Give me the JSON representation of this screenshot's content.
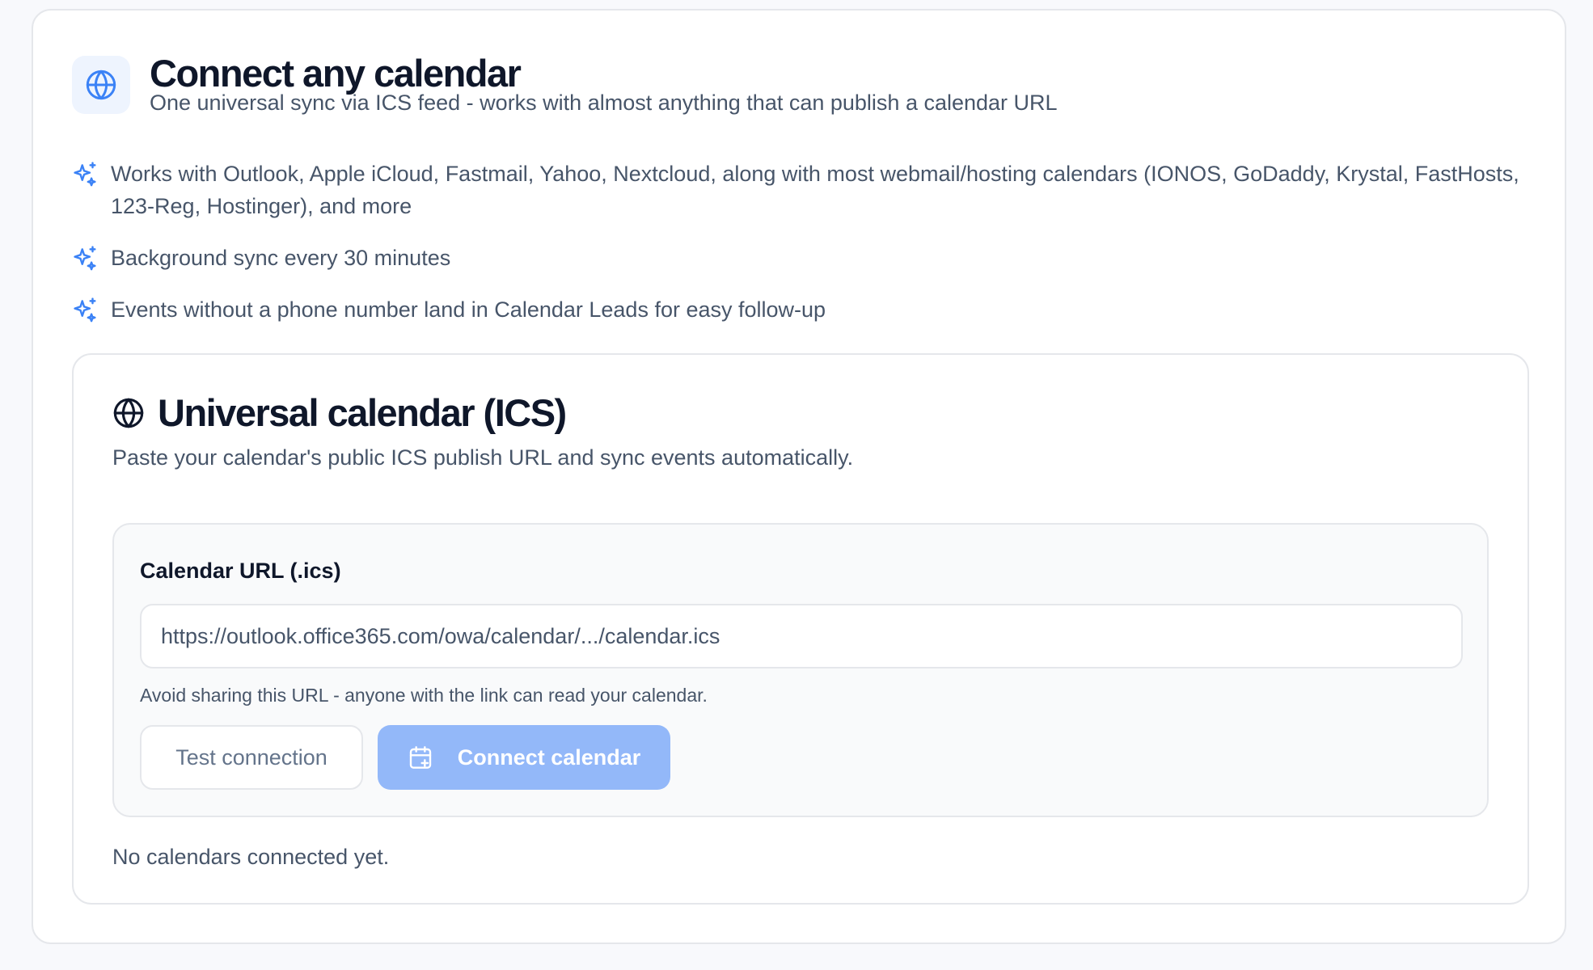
{
  "header": {
    "icon": "globe-icon",
    "title": "Connect any calendar",
    "subtitle": "One universal sync via ICS feed - works with almost anything that can publish a calendar URL"
  },
  "features": [
    "Works with Outlook, Apple iCloud, Fastmail, Yahoo, Nextcloud, along with most webmail/hosting calendars (IONOS, GoDaddy, Krystal, FastHosts, 123-Reg, Hostinger), and more",
    "Background sync every 30 minutes",
    "Events without a phone number land in Calendar Leads for easy follow-up"
  ],
  "ics_card": {
    "icon": "globe-icon",
    "title": "Universal calendar (ICS)",
    "description": "Paste your calendar's public ICS publish URL and sync events automatically.",
    "form": {
      "label": "Calendar URL (.ics)",
      "value": "",
      "placeholder": "https://outlook.office365.com/owa/calendar/.../calendar.ics",
      "hint": "Avoid sharing this URL - anyone with the link can read your calendar.",
      "test_label": "Test connection",
      "connect_label": "Connect calendar",
      "connect_icon": "calendar-plus-icon"
    },
    "empty_state": "No calendars connected yet."
  },
  "colors": {
    "accent": "#3b82f6",
    "accent_disabled": "#93b8f9",
    "text_primary": "#0f172a",
    "text_secondary": "#475569",
    "border": "#e5e7eb"
  }
}
